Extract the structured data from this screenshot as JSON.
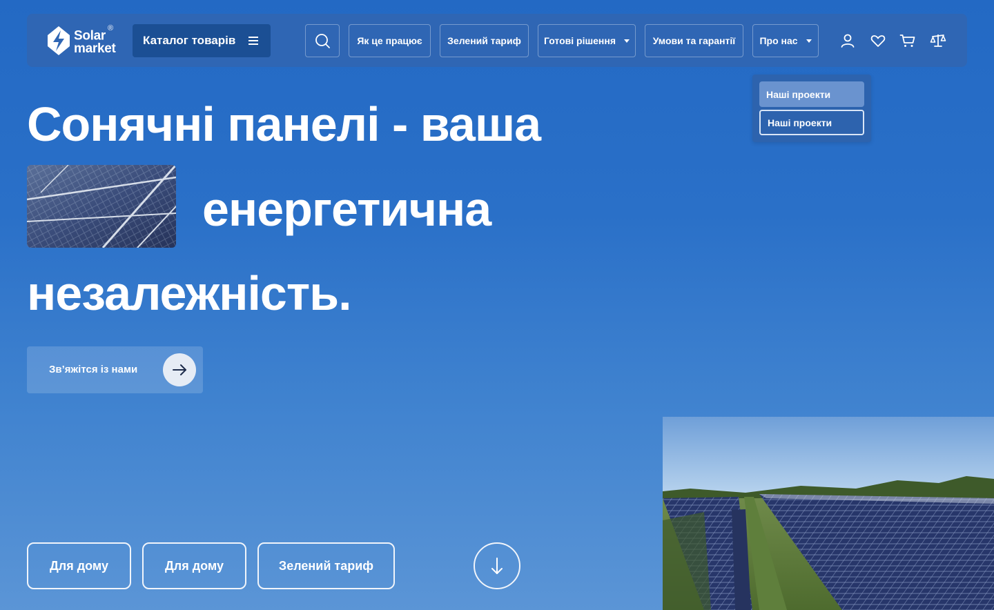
{
  "header": {
    "logo_line1": "Solar",
    "logo_registered": "®",
    "logo_line2": "market",
    "catalog_label": "Каталог товарів",
    "nav": {
      "how_it_works": "Як це працює",
      "green_tariff": "Зелений тариф",
      "ready_solutions": "Готові рішення",
      "terms": "Умови та гарантії",
      "about": "Про нас"
    },
    "icons": [
      "search-icon",
      "user-icon",
      "heart-icon",
      "cart-icon",
      "compare-scales-icon"
    ]
  },
  "dropdown": {
    "items": [
      "Наші проекти",
      "Наші проекти"
    ]
  },
  "hero": {
    "line1": "Сонячні панелі - ваша",
    "line2": "енергетична",
    "line3": "незалежність.",
    "contact_label": "Зв’яжітся із нами"
  },
  "bottom": {
    "pills": [
      "Для дому",
      "Для дому",
      "Зелений тариф"
    ]
  },
  "colors": {
    "background": "#2369c4",
    "header": "#2f66b4",
    "catalog_button": "#1b4f94",
    "dropdown_active": "#6a93cf"
  }
}
